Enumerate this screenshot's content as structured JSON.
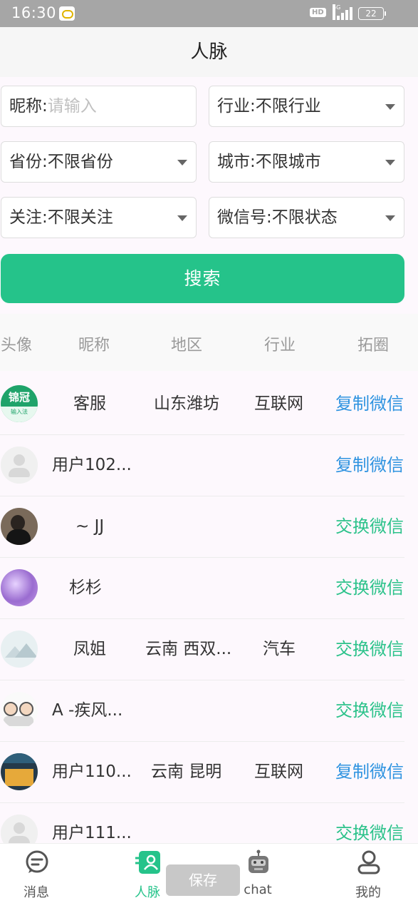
{
  "status_bar": {
    "time": "16:30",
    "network": "5G",
    "hd": "HD",
    "battery": "22"
  },
  "title": "人脉",
  "filters": {
    "nickname_label": "昵称:",
    "nickname_placeholder": "请输入",
    "industry": "行业:不限行业",
    "province": "省份:不限省份",
    "city": "城市:不限城市",
    "follow": "关注:不限关注",
    "wechat": "微信号:不限状态"
  },
  "search_label": "搜索",
  "columns": [
    "头像",
    "昵称",
    "地区",
    "行业",
    "拓圈"
  ],
  "rows": [
    {
      "nickname": "客服",
      "region": "山东潍坊",
      "industry": "互联网",
      "action": "复制微信",
      "action_type": "copy",
      "avatar": "logo"
    },
    {
      "nickname": "用户102...",
      "region": "",
      "industry": "",
      "action": "复制微信",
      "action_type": "copy",
      "avatar": "default"
    },
    {
      "nickname": "~ JJ",
      "region": "",
      "industry": "",
      "action": "交换微信",
      "action_type": "swap",
      "avatar": "photo-dark"
    },
    {
      "nickname": "杉杉",
      "region": "",
      "industry": "",
      "action": "交换微信",
      "action_type": "swap",
      "avatar": "photo-purple"
    },
    {
      "nickname": "凤姐",
      "region": "云南 西双...",
      "industry": "汽车",
      "action": "交换微信",
      "action_type": "swap",
      "avatar": "photo-landscape"
    },
    {
      "nickname": "A -疾风...",
      "region": "",
      "industry": "",
      "action": "交换微信",
      "action_type": "swap",
      "avatar": "cartoon"
    },
    {
      "nickname": "用户110...",
      "region": "云南 昆明",
      "industry": "互联网",
      "action": "复制微信",
      "action_type": "copy",
      "avatar": "photo-shop"
    },
    {
      "nickname": "用户111...",
      "region": "",
      "industry": "",
      "action": "交换微信",
      "action_type": "swap",
      "avatar": "default"
    }
  ],
  "tabs": [
    {
      "label": "消息",
      "icon": "message-icon"
    },
    {
      "label": "人脉",
      "icon": "contacts-icon",
      "active": true
    },
    {
      "label": "chat",
      "icon": "robot-icon"
    },
    {
      "label": "我的",
      "icon": "profile-icon"
    }
  ],
  "save_label": "保存",
  "colors": {
    "accent": "#25c38a",
    "copy": "#2e93e0",
    "swap": "#2bc28a"
  }
}
